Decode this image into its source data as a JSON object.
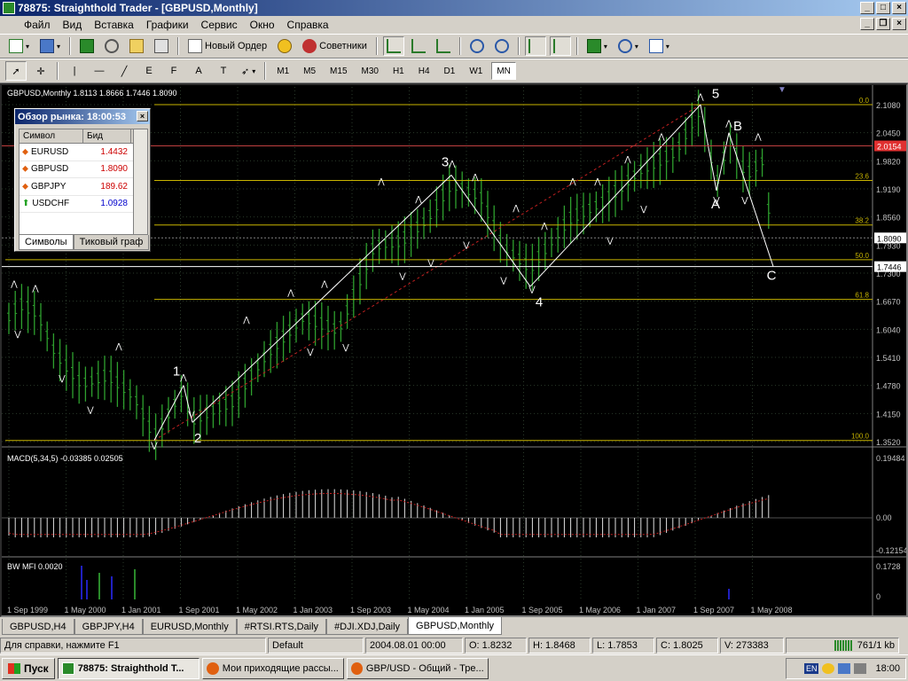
{
  "window": {
    "title": "78875: Straighthold Trader - [GBPUSD,Monthly]"
  },
  "menu": [
    "Файл",
    "Вид",
    "Вставка",
    "Графики",
    "Сервис",
    "Окно",
    "Справка"
  ],
  "toolbar": {
    "new_order": "Новый Ордер",
    "experts": "Советники",
    "timeframes": [
      "M1",
      "M5",
      "M15",
      "M30",
      "H1",
      "H4",
      "D1",
      "W1",
      "MN"
    ],
    "active_timeframe": "MN"
  },
  "chart": {
    "header": "GBPUSD,Monthly  1.8113 1.8666 1.7446 1.8090",
    "price_labels": [
      "2.1080",
      "2.0450",
      "1.9820",
      "1.9190",
      "1.8560",
      "1.7930",
      "1.7300",
      "1.6670",
      "1.6040",
      "1.5410",
      "1.4780",
      "1.4150",
      "1.3520"
    ],
    "current_price": "1.8090",
    "line_price": "2.0154",
    "low_price": "1.7446",
    "fib_levels": [
      "0.0",
      "23.6",
      "38.2",
      "50.0",
      "61.8",
      "100.0"
    ],
    "wave_labels": [
      "1",
      "2",
      "3",
      "4",
      "5",
      "A",
      "B",
      "C"
    ],
    "macd": {
      "header": "MACD(5,34,5) -0.03385 0.02505",
      "scale": [
        "0.19484",
        "0.00",
        "-0.12154"
      ]
    },
    "bwmfi": {
      "header": "BW MFI 0.0020",
      "scale": [
        "0.1728",
        "0"
      ]
    },
    "dates": [
      "1 Sep 1999",
      "1 May 2000",
      "1 Jan 2001",
      "1 Sep 2001",
      "1 May 2002",
      "1 Jan 2003",
      "1 Sep 2003",
      "1 May 2004",
      "1 Jan 2005",
      "1 Sep 2005",
      "1 May 2006",
      "1 Jan 2007",
      "1 Sep 2007",
      "1 May 2008"
    ]
  },
  "market_watch": {
    "title": "Обзор рынка: 18:00:53",
    "col_symbol": "Символ",
    "col_bid": "Бид",
    "rows": [
      {
        "symbol": "EURUSD",
        "bid": "1.4432",
        "dir": "down",
        "color": "#cc0000"
      },
      {
        "symbol": "GBPUSD",
        "bid": "1.8090",
        "dir": "down",
        "color": "#cc0000"
      },
      {
        "symbol": "GBPJPY",
        "bid": "189.62",
        "dir": "down",
        "color": "#cc0000"
      },
      {
        "symbol": "USDCHF",
        "bid": "1.0928",
        "dir": "up",
        "color": "#0000cc"
      }
    ],
    "tabs": [
      "Символы",
      "Тиковый граф"
    ]
  },
  "chart_tabs": [
    "GBPUSD,H4",
    "GBPJPY,H4",
    "EURUSD,Monthly",
    "#RTSI.RTS,Daily",
    "#DJI.XDJ,Daily",
    "GBPUSD,Monthly"
  ],
  "active_tab": "GBPUSD,Monthly",
  "status": {
    "help": "Для справки, нажмите F1",
    "profile": "Default",
    "time": "2004.08.01 00:00",
    "open": "O: 1.8232",
    "high": "H: 1.8468",
    "low": "L: 1.7853",
    "close": "C: 1.8025",
    "volume": "V: 273383",
    "traffic": "761/1 kb"
  },
  "taskbar": {
    "start": "Пуск",
    "tasks": [
      "78875: Straighthold T...",
      "Мои приходящие рассы...",
      "GBP/USD - Общий - Тре..."
    ],
    "lang": "EN",
    "clock": "18:00"
  }
}
